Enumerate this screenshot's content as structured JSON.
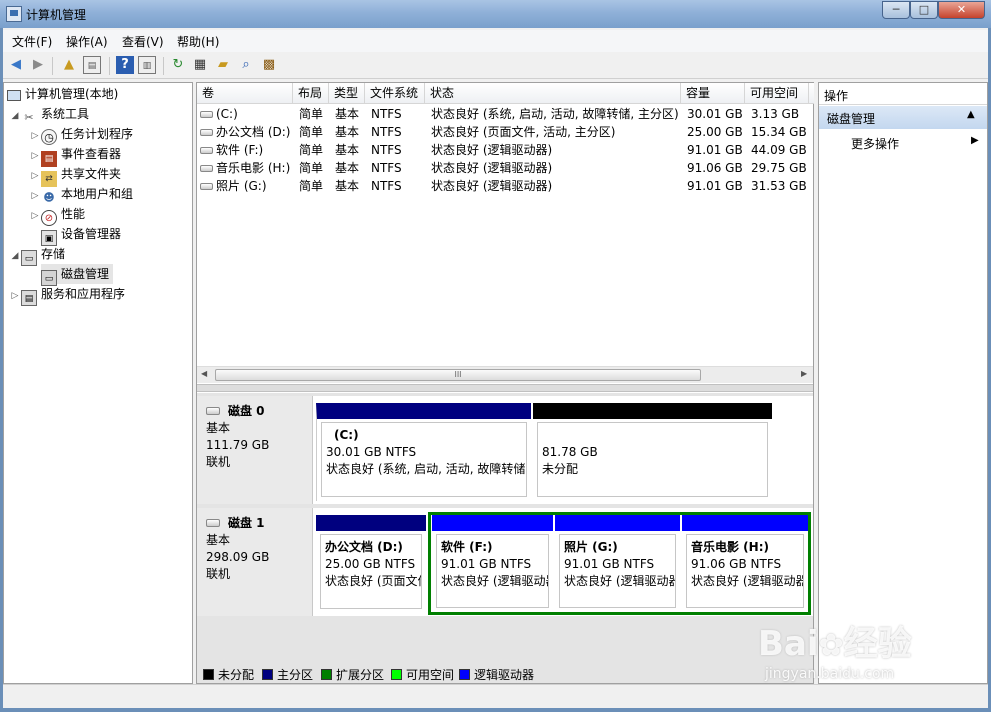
{
  "window": {
    "title": "计算机管理",
    "min": "─",
    "max": "□",
    "close": "✕"
  },
  "menu": [
    "文件(F)",
    "操作(A)",
    "查看(V)",
    "帮助(H)"
  ],
  "tree": {
    "root": "计算机管理(本地)",
    "system_tools": "系统工具",
    "task_scheduler": "任务计划程序",
    "event_viewer": "事件查看器",
    "shared_folders": "共享文件夹",
    "local_users": "本地用户和组",
    "performance": "性能",
    "device_manager": "设备管理器",
    "storage": "存储",
    "disk_management": "磁盘管理",
    "services": "服务和应用程序"
  },
  "columns": [
    "卷",
    "布局",
    "类型",
    "文件系统",
    "状态",
    "容量",
    "可用空间"
  ],
  "volumes": [
    {
      "vol": "(C:)",
      "layout": "简单",
      "type": "基本",
      "fs": "NTFS",
      "status": "状态良好 (系统, 启动, 活动, 故障转储, 主分区)",
      "capacity": "30.01 GB",
      "free": "3.13 GB"
    },
    {
      "vol": "办公文档 (D:)",
      "layout": "简单",
      "type": "基本",
      "fs": "NTFS",
      "status": "状态良好 (页面文件, 活动, 主分区)",
      "capacity": "25.00 GB",
      "free": "15.34 GB"
    },
    {
      "vol": "软件 (F:)",
      "layout": "简单",
      "type": "基本",
      "fs": "NTFS",
      "status": "状态良好 (逻辑驱动器)",
      "capacity": "91.01 GB",
      "free": "44.09 GB"
    },
    {
      "vol": "音乐电影 (H:)",
      "layout": "简单",
      "type": "基本",
      "fs": "NTFS",
      "status": "状态良好 (逻辑驱动器)",
      "capacity": "91.06 GB",
      "free": "29.75 GB"
    },
    {
      "vol": "照片 (G:)",
      "layout": "简单",
      "type": "基本",
      "fs": "NTFS",
      "status": "状态良好 (逻辑驱动器)",
      "capacity": "91.01 GB",
      "free": "31.53 GB"
    }
  ],
  "scroll_grip": "III",
  "disks": [
    {
      "name": "磁盘 0",
      "type": "基本",
      "size": "111.79 GB",
      "state": "联机",
      "partitions": [
        {
          "name": "(C:)",
          "size": "30.01 GB NTFS",
          "status": "状态良好 (系统, 启动, 活动, 故障转储,"
        },
        {
          "name": "",
          "size": "81.78 GB",
          "status": "未分配"
        }
      ]
    },
    {
      "name": "磁盘 1",
      "type": "基本",
      "size": "298.09 GB",
      "state": "联机",
      "partitions": [
        {
          "name": "办公文档 (D:)",
          "size": "25.00 GB NTFS",
          "status": "状态良好 (页面文件"
        },
        {
          "name": "软件 (F:)",
          "size": "91.01 GB NTFS",
          "status": "状态良好 (逻辑驱动器"
        },
        {
          "name": "照片 (G:)",
          "size": "91.01 GB NTFS",
          "status": "状态良好 (逻辑驱动器"
        },
        {
          "name": "音乐电影 (H:)",
          "size": "91.06 GB NTFS",
          "status": "状态良好 (逻辑驱动器"
        }
      ]
    }
  ],
  "legend": [
    {
      "label": "未分配",
      "color": "#000000"
    },
    {
      "label": "主分区",
      "color": "#00007f"
    },
    {
      "label": "扩展分区",
      "color": "#007f00"
    },
    {
      "label": "可用空间",
      "color": "#00ff00"
    },
    {
      "label": "逻辑驱动器",
      "color": "#0000ff"
    }
  ],
  "actions": {
    "header": "操作",
    "section": "磁盘管理",
    "more": "更多操作"
  },
  "watermark": {
    "brand": "Bai",
    "brand2": "经验",
    "url": "jingyan.baidu.com"
  },
  "colors": {
    "primary": "#00007f",
    "unallocated": "#000000",
    "extended": "#007f00",
    "logical": "#0000ff"
  }
}
